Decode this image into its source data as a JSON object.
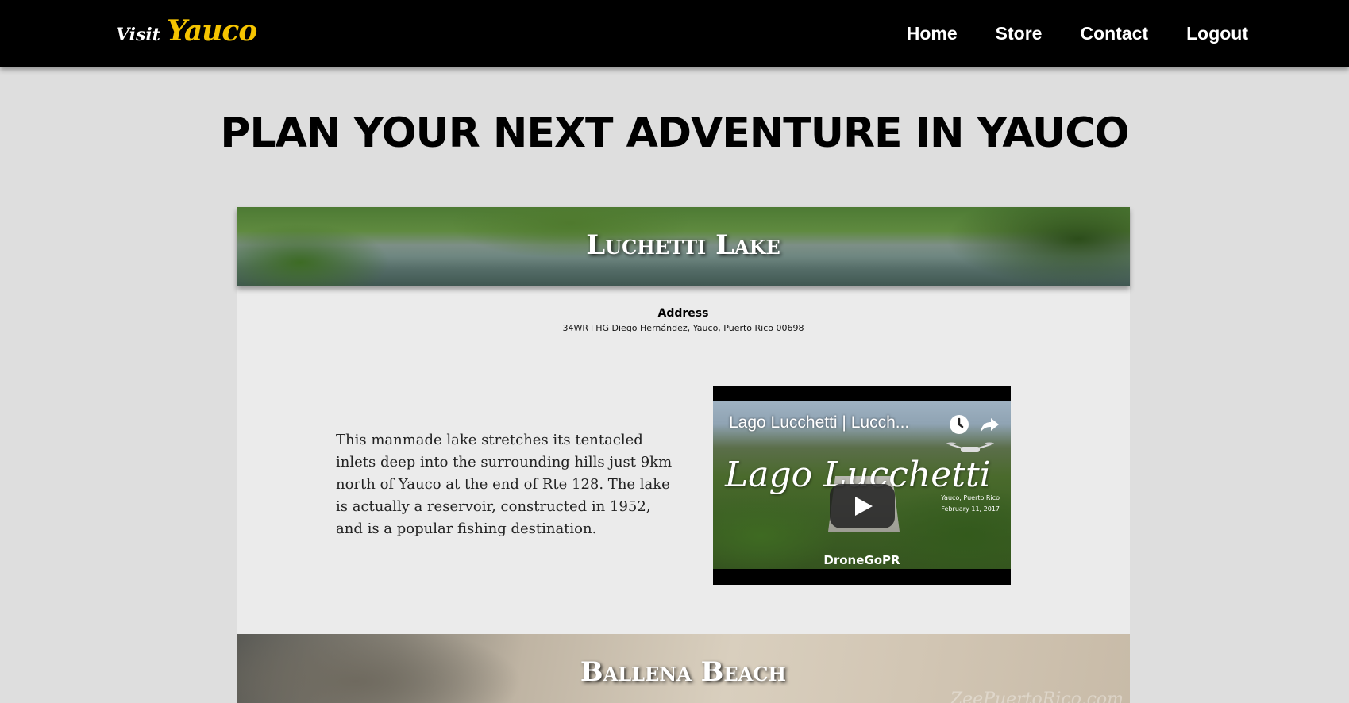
{
  "header": {
    "logo_visit": "Visit",
    "logo_brand": "Yauco",
    "nav": [
      {
        "label": "Home"
      },
      {
        "label": "Store"
      },
      {
        "label": "Contact"
      },
      {
        "label": "Logout"
      }
    ]
  },
  "page_title": "PLAN YOUR NEXT ADVENTURE IN YAUCO",
  "attractions": [
    {
      "name": "Luchetti Lake",
      "address_label": "Address",
      "address": "34WR+HG Diego Hernández, Yauco, Puerto Rico 00698",
      "description": "This manmade lake stretches its tentacled inlets deep into the surrounding hills just 9km north of Yauco at the end of Rte 128. The lake is actually a reservoir, constructed in 1952, and is a popular fishing destination.",
      "video": {
        "title": "Lago Lucchetti | Lucch...",
        "overlay_script": "Lago Lucchetti",
        "location": "Yauco, Puerto Rico",
        "date": "February 11, 2017",
        "credit": "DroneGoPR",
        "icons": [
          "clock-icon",
          "share-icon",
          "play-icon",
          "drone-icon"
        ]
      }
    },
    {
      "name": "Ballena Beach",
      "watermark": "ZeePuertoRico.com"
    }
  ],
  "colors": {
    "topbar": "#000000",
    "brand_yellow": "#f5c400",
    "page_bg": "#dedede",
    "card_bg": "#ebebeb"
  }
}
